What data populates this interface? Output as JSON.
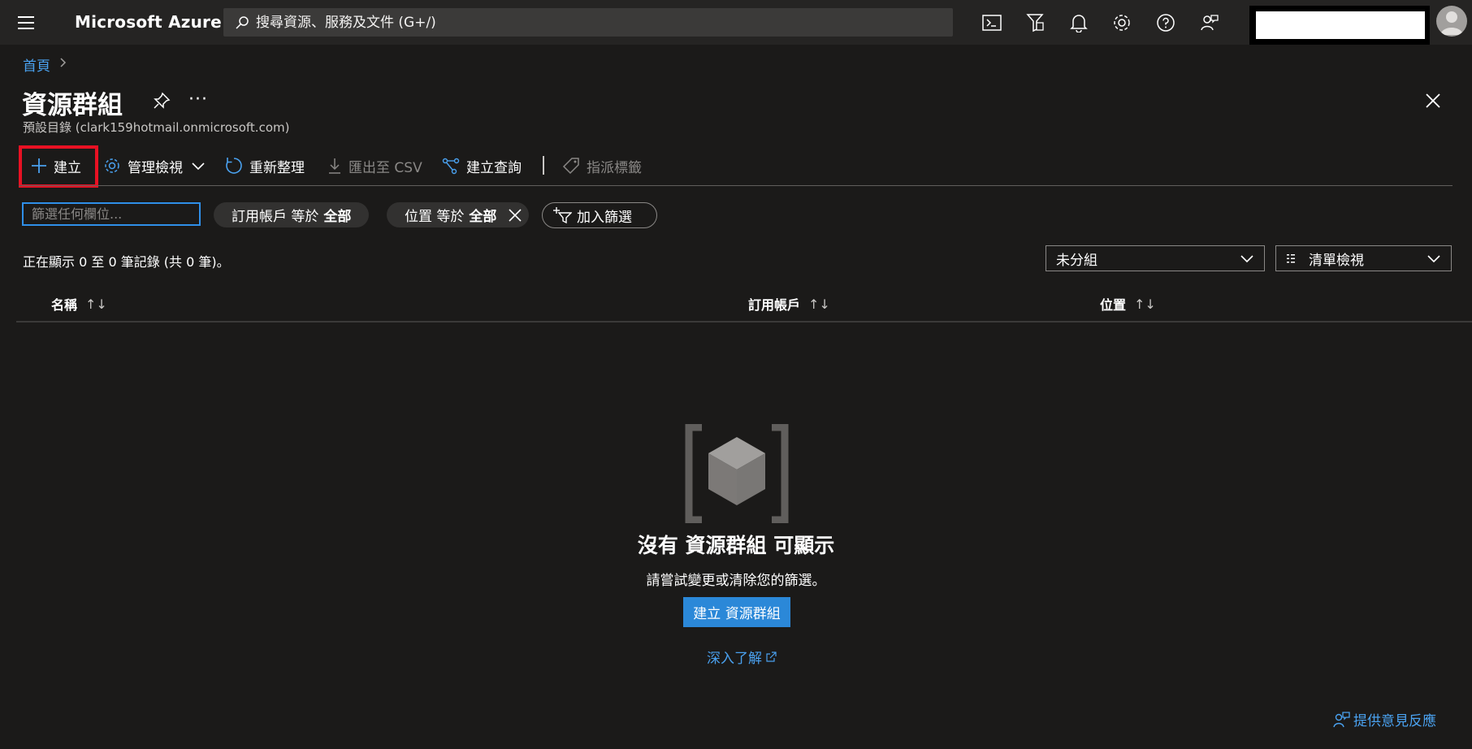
{
  "topbar": {
    "brand": "Microsoft Azure",
    "search_placeholder": "搜尋資源、服務及文件 (G+/)"
  },
  "breadcrumb": {
    "home": "首頁"
  },
  "header": {
    "title": "資源群組",
    "more": "···",
    "subtitle": "預設目錄 (clark159hotmail.onmicrosoft.com)"
  },
  "toolbar": {
    "create": "建立",
    "manage_view": "管理檢視",
    "refresh": "重新整理",
    "export_csv": "匯出至 CSV",
    "open_query": "建立查詢",
    "assign_tags": "指派標籤"
  },
  "filters": {
    "input_placeholder": "篩選任何欄位...",
    "subscription_label": "訂用帳戶 等於",
    "subscription_value": "全部",
    "location_label": "位置 等於",
    "location_value": "全部",
    "add_filter": "加入篩選"
  },
  "records_text": "正在顯示 0 至 0 筆記錄 (共 0 筆)。",
  "grouping": {
    "selected": "未分組"
  },
  "view_mode": {
    "selected": "清單檢視"
  },
  "table": {
    "columns": [
      "名稱",
      "訂用帳戶",
      "位置"
    ],
    "sort_glyph": "↑↓",
    "rows": []
  },
  "empty_state": {
    "title": "沒有 資源群組 可顯示",
    "subtitle": "請嘗試變更或清除您的篩選。",
    "create_button": "建立 資源群組",
    "learn_more": "深入了解"
  },
  "feedback": "提供意見反應",
  "colors": {
    "background": "#1b1a19",
    "topbar": "#252423",
    "accent": "#2b88d8",
    "link": "#4aa1ef",
    "highlight": "#e81123"
  }
}
